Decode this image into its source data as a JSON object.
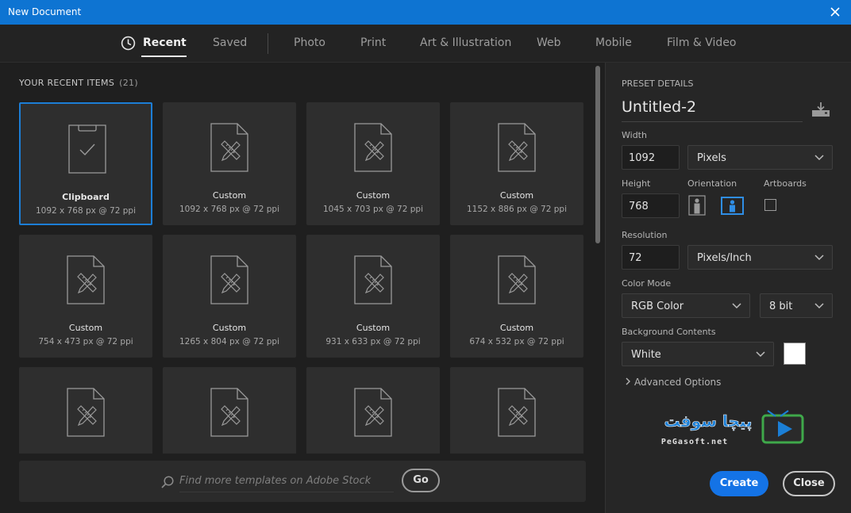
{
  "window": {
    "title": "New Document"
  },
  "tabs": [
    {
      "label": "Recent",
      "active": true
    },
    {
      "label": "Saved"
    },
    {
      "label": "Photo"
    },
    {
      "label": "Print"
    },
    {
      "label": "Art & Illustration"
    },
    {
      "label": "Web"
    },
    {
      "label": "Mobile"
    },
    {
      "label": "Film & Video"
    }
  ],
  "recent": {
    "heading": "YOUR RECENT ITEMS",
    "count": "(21)",
    "items": [
      {
        "name": "Clipboard",
        "size": "1092 x 768 px @ 72 ppi",
        "icon": "clipboard-check-icon",
        "selected": true
      },
      {
        "name": "Custom",
        "size": "1092 x 768 px @ 72 ppi",
        "icon": "custom-document-icon"
      },
      {
        "name": "Custom",
        "size": "1045 x 703 px @ 72 ppi",
        "icon": "custom-document-icon"
      },
      {
        "name": "Custom",
        "size": "1152 x 886 px @ 72 ppi",
        "icon": "custom-document-icon"
      },
      {
        "name": "Custom",
        "size": "754 x 473 px @ 72 ppi",
        "icon": "custom-document-icon"
      },
      {
        "name": "Custom",
        "size": "1265 x 804 px @ 72 ppi",
        "icon": "custom-document-icon"
      },
      {
        "name": "Custom",
        "size": "931 x 633 px @ 72 ppi",
        "icon": "custom-document-icon"
      },
      {
        "name": "Custom",
        "size": "674 x 532 px @ 72 ppi",
        "icon": "custom-document-icon"
      },
      {
        "name": "",
        "size": "",
        "icon": "custom-document-icon"
      },
      {
        "name": "",
        "size": "",
        "icon": "custom-document-icon"
      },
      {
        "name": "",
        "size": "",
        "icon": "custom-document-icon"
      },
      {
        "name": "",
        "size": "",
        "icon": "custom-document-icon"
      }
    ]
  },
  "stock": {
    "placeholder": "Find more templates on Adobe Stock",
    "go_label": "Go"
  },
  "preset": {
    "section_label": "PRESET DETAILS",
    "name": "Untitled-2",
    "width_label": "Width",
    "width_value": "1092",
    "width_unit": "Pixels",
    "height_label": "Height",
    "height_value": "768",
    "orientation_label": "Orientation",
    "artboards_label": "Artboards",
    "resolution_label": "Resolution",
    "resolution_value": "72",
    "resolution_unit": "Pixels/Inch",
    "color_mode_label": "Color Mode",
    "color_mode": "RGB Color",
    "bit_depth": "8 bit",
    "background_label": "Background Contents",
    "background": "White",
    "background_swatch": "#ffffff",
    "advanced_label": "Advanced Options"
  },
  "buttons": {
    "create": "Create",
    "close": "Close"
  },
  "watermark": {
    "line1": "پیچا سوفت",
    "line2": "PeGasoft.net"
  },
  "colors": {
    "titlebar": "#0e74d2",
    "accent": "#1473e6",
    "selection": "#1c7ed6"
  }
}
